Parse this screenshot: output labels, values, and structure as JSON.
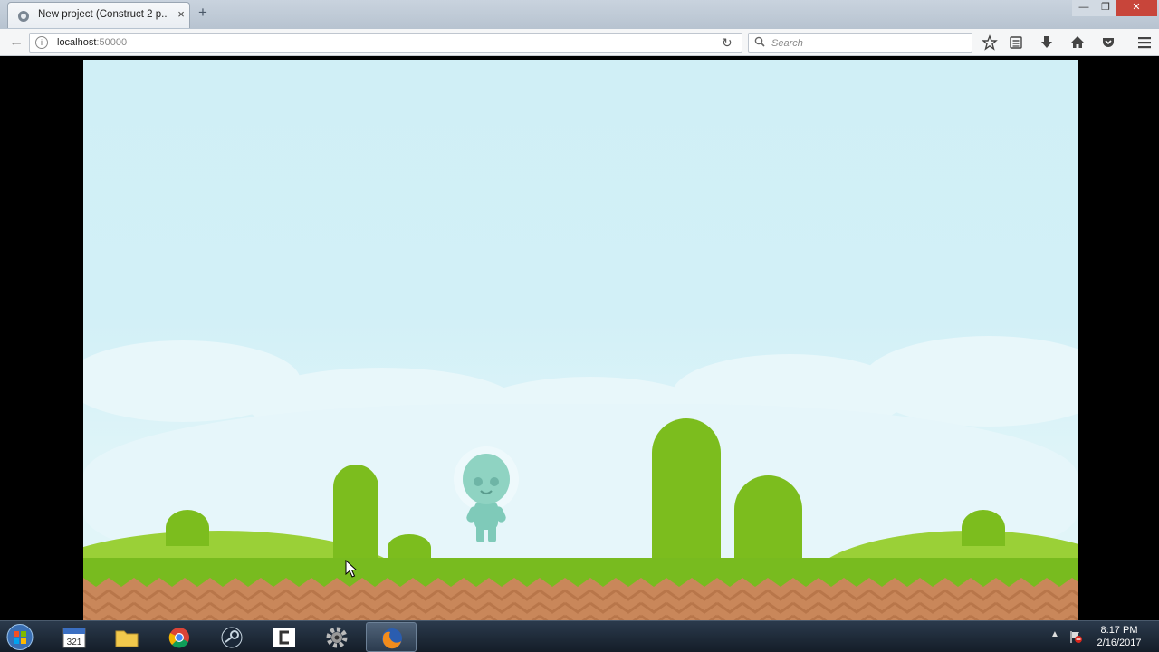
{
  "browser": {
    "tab_title": "New project (Construct 2 p...",
    "tab_close": "×",
    "new_tab": "+",
    "url_host": "localhost",
    "url_port": ":50000",
    "search_placeholder": "Search",
    "window_min": "—",
    "window_max": "❐",
    "window_close": "✕"
  },
  "toolbar_icons": [
    "bookmark-star-icon",
    "reading-list-icon",
    "download-icon",
    "home-icon",
    "pocket-icon",
    "menu-icon"
  ],
  "game": {
    "scene": "platformer-level",
    "character": "teal-alien-astronaut"
  },
  "taskbar": {
    "apps": [
      "calendar-app",
      "file-explorer",
      "chrome",
      "steam",
      "construct",
      "settings",
      "firefox"
    ],
    "active_app": "firefox",
    "clock_time": "8:17 PM",
    "clock_date": "2/16/2017"
  },
  "colors": {
    "sky": "#d0eff6",
    "grass": "#7cbd1e",
    "dirt": "#c9875a",
    "character": "#8fd3c2"
  }
}
